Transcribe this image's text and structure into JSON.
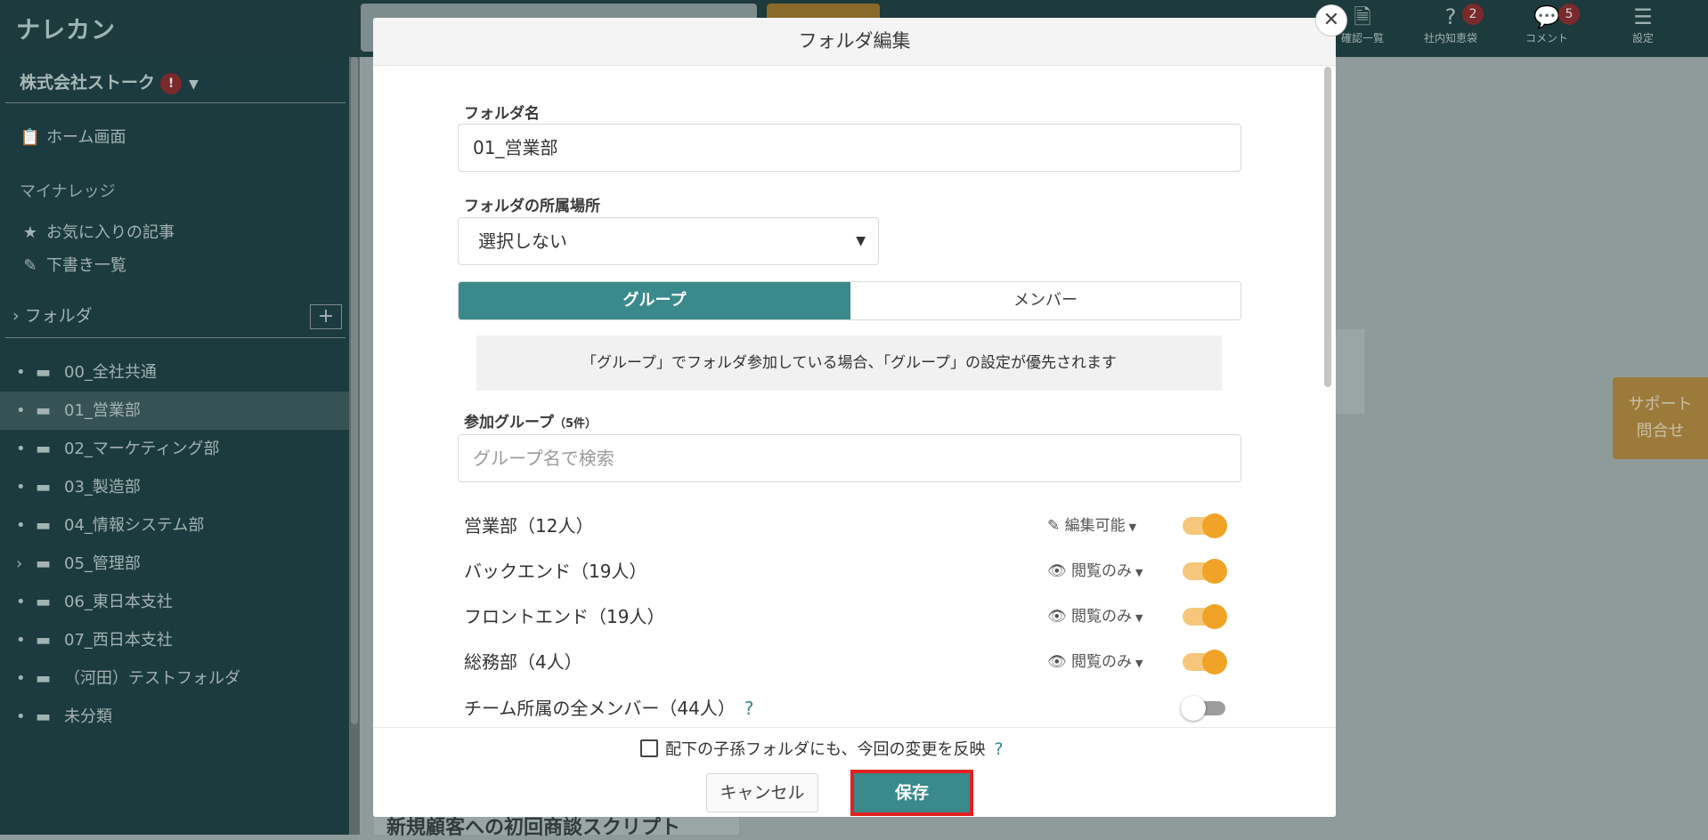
{
  "app": {
    "logo": "ナレカン"
  },
  "header": {
    "icons": [
      {
        "name": "confirm-list",
        "label": "確認一覧",
        "badge": ""
      },
      {
        "name": "knowledge",
        "label": "社内知恵袋",
        "badge": "2"
      },
      {
        "name": "comment",
        "label": "コメント",
        "badge": "5"
      },
      {
        "name": "settings",
        "label": "設定",
        "badge": ""
      }
    ]
  },
  "sidebar": {
    "company": "株式会社ストーク",
    "company_alert": "!",
    "home": "ホーム画面",
    "my_knowledge": "マイナレッジ",
    "favorites": "お気に入りの記事",
    "drafts": "下書き一覧",
    "folder_heading": "フォルダ",
    "folders": [
      {
        "name": "00_全社共通",
        "bullet": "•"
      },
      {
        "name": "01_営業部",
        "bullet": "•"
      },
      {
        "name": "02_マーケティング部",
        "bullet": "•"
      },
      {
        "name": "03_製造部",
        "bullet": "•"
      },
      {
        "name": "04_情報システム部",
        "bullet": "•"
      },
      {
        "name": "05_管理部",
        "bullet": "›"
      },
      {
        "name": "06_東日本支社",
        "bullet": "•"
      },
      {
        "name": "07_西日本支社",
        "bullet": "•"
      },
      {
        "name": "（河田）テストフォルダ",
        "bullet": "•"
      },
      {
        "name": "未分類",
        "bullet": "•"
      }
    ]
  },
  "background": {
    "article_title": "新規顧客への初回商談スクリプト",
    "support_line1": "サポート",
    "support_line2": "問合せ"
  },
  "modal": {
    "title": "フォルダ編集",
    "folder_name_label": "フォルダ名",
    "folder_name_value": "01_営業部",
    "location_label": "フォルダの所属場所",
    "location_value": "選択しない",
    "tab_group": "グループ",
    "tab_member": "メンバー",
    "notice": "「グループ」でフォルダ参加している場合、「グループ」の設定が優先されます",
    "groups_label": "参加グループ",
    "groups_count": "（5件）",
    "search_placeholder": "グループ名で検索",
    "groups": [
      {
        "name": "営業部（12人）",
        "permission": "編集可能",
        "perm_icon": "pencil-icon",
        "enabled": true
      },
      {
        "name": "バックエンド（19人）",
        "permission": "閲覧のみ",
        "perm_icon": "eye-icon",
        "enabled": true
      },
      {
        "name": "フロントエンド（19人）",
        "permission": "閲覧のみ",
        "perm_icon": "eye-icon",
        "enabled": true
      },
      {
        "name": "総務部（4人）",
        "permission": "閲覧のみ",
        "perm_icon": "eye-icon",
        "enabled": true
      }
    ],
    "all_members": {
      "name": "チーム所属の全メンバー（44人）",
      "enabled": false
    },
    "reflect_children": "配下の子孫フォルダにも、今回の変更を反映",
    "cancel": "キャンセル",
    "save": "保存"
  },
  "colors": {
    "teal": "#3a8a8c",
    "orange": "#f0a326",
    "highlight": "#e32020"
  }
}
